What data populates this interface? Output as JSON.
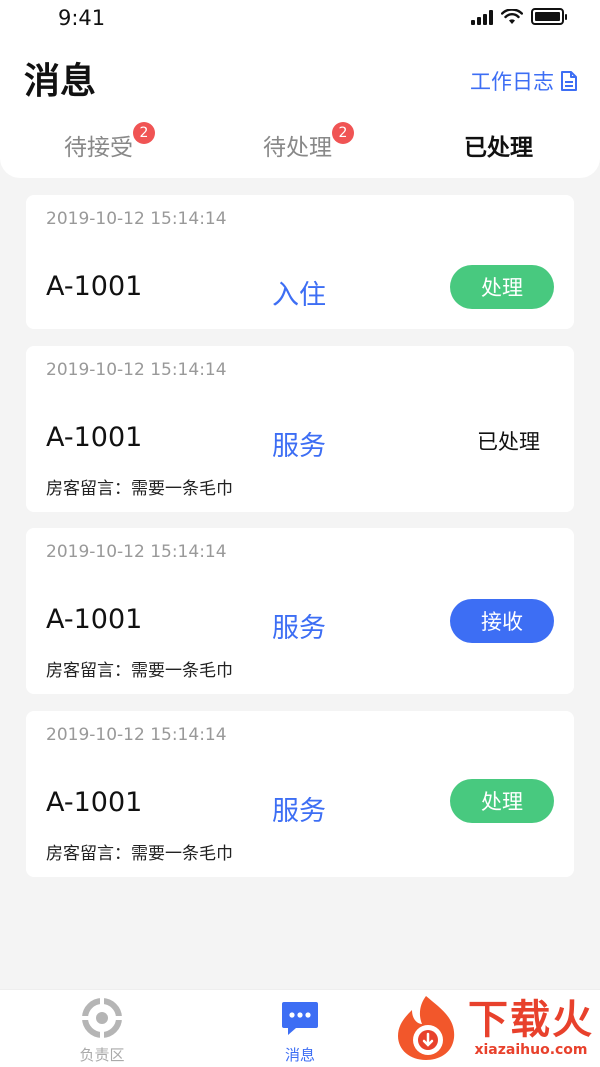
{
  "status_bar": {
    "time": "9:41"
  },
  "header": {
    "title": "消息",
    "work_log_label": "工作日志"
  },
  "tabs": [
    {
      "label": "待接受",
      "badge": "2"
    },
    {
      "label": "待处理",
      "badge": "2"
    },
    {
      "label": "已处理",
      "badge": ""
    }
  ],
  "cards": [
    {
      "time": "2019-10-12 15:14:14",
      "room": "A-1001",
      "type": "入住",
      "message": "",
      "action": "处理",
      "status": ""
    },
    {
      "time": "2019-10-12 15:14:14",
      "room": "A-1001",
      "type": "服务",
      "message": "房客留言：需要一条毛巾",
      "action": "",
      "status": "已处理"
    },
    {
      "time": "2019-10-12 15:14:14",
      "room": "A-1001",
      "type": "服务",
      "message": "房客留言：需要一条毛巾",
      "action": "接收",
      "status": ""
    },
    {
      "time": "2019-10-12 15:14:14",
      "room": "A-1001",
      "type": "服务",
      "message": "房客留言：需要一条毛巾",
      "action": "处理",
      "status": ""
    }
  ],
  "tabbar": [
    {
      "label": "负责区",
      "icon": "target-icon"
    },
    {
      "label": "消息",
      "icon": "chat-icon"
    }
  ],
  "watermark": {
    "brand": "下载火",
    "site": "xiazaihuo.com"
  },
  "colors": {
    "accent": "#3d6ef4",
    "green": "#48c97f",
    "badge": "#f05454"
  }
}
